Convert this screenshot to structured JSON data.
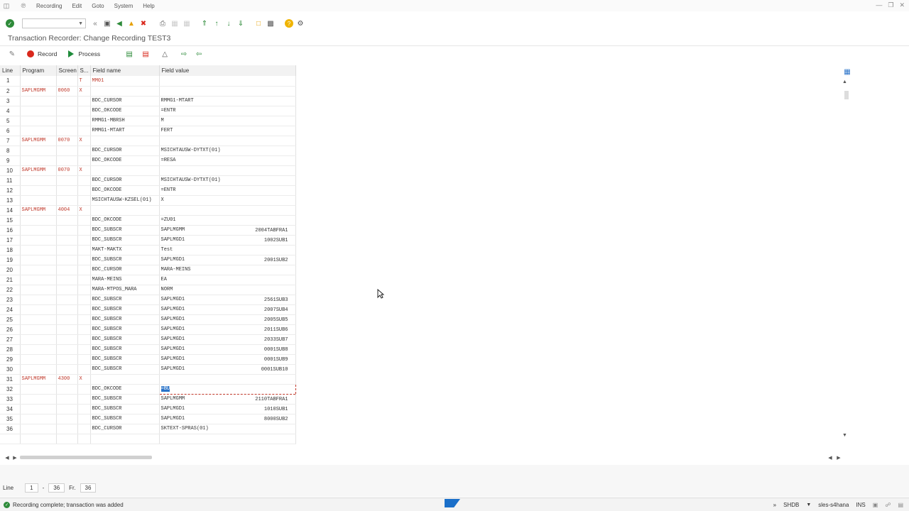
{
  "menu": {
    "items": [
      "Recording",
      "Edit",
      "Goto",
      "System",
      "Help"
    ]
  },
  "window_title": "Transaction Recorder: Change Recording TEST3",
  "toolbar": {
    "record_label": "Record",
    "process_label": "Process"
  },
  "grid": {
    "columns": [
      "Line",
      "Program",
      "Screen",
      "S...",
      "Field name",
      "Field value"
    ],
    "rows": [
      {
        "line": "1",
        "program": "",
        "screen": "",
        "s": "T",
        "field": "MM01",
        "value": "",
        "extra": ""
      },
      {
        "line": "2",
        "program": "SAPLMGMM",
        "screen": "0060",
        "s": "X",
        "field": "",
        "value": "",
        "extra": ""
      },
      {
        "line": "3",
        "program": "",
        "screen": "",
        "s": "",
        "field": "BDC_CURSOR",
        "value": "RMMG1-MTART",
        "extra": ""
      },
      {
        "line": "4",
        "program": "",
        "screen": "",
        "s": "",
        "field": "BDC_OKCODE",
        "value": "=ENTR",
        "extra": ""
      },
      {
        "line": "5",
        "program": "",
        "screen": "",
        "s": "",
        "field": "RMMG1-MBRSH",
        "value": "M",
        "extra": ""
      },
      {
        "line": "6",
        "program": "",
        "screen": "",
        "s": "",
        "field": "RMMG1-MTART",
        "value": "FERT",
        "extra": ""
      },
      {
        "line": "7",
        "program": "SAPLMGMM",
        "screen": "0070",
        "s": "X",
        "field": "",
        "value": "",
        "extra": ""
      },
      {
        "line": "8",
        "program": "",
        "screen": "",
        "s": "",
        "field": "BDC_CURSOR",
        "value": "MSICHTAUSW-DYTXT(01)",
        "extra": ""
      },
      {
        "line": "9",
        "program": "",
        "screen": "",
        "s": "",
        "field": "BDC_OKCODE",
        "value": "=RESA",
        "extra": ""
      },
      {
        "line": "10",
        "program": "SAPLMGMM",
        "screen": "0070",
        "s": "X",
        "field": "",
        "value": "",
        "extra": ""
      },
      {
        "line": "11",
        "program": "",
        "screen": "",
        "s": "",
        "field": "BDC_CURSOR",
        "value": "MSICHTAUSW-DYTXT(01)",
        "extra": ""
      },
      {
        "line": "12",
        "program": "",
        "screen": "",
        "s": "",
        "field": "BDC_OKCODE",
        "value": "=ENTR",
        "extra": ""
      },
      {
        "line": "13",
        "program": "",
        "screen": "",
        "s": "",
        "field": "MSICHTAUSW-KZSEL(01)",
        "value": "X",
        "extra": ""
      },
      {
        "line": "14",
        "program": "SAPLMGMM",
        "screen": "4004",
        "s": "X",
        "field": "",
        "value": "",
        "extra": ""
      },
      {
        "line": "15",
        "program": "",
        "screen": "",
        "s": "",
        "field": "BDC_OKCODE",
        "value": "=ZU01",
        "extra": ""
      },
      {
        "line": "16",
        "program": "",
        "screen": "",
        "s": "",
        "field": "BDC_SUBSCR",
        "value": "SAPLMGMM",
        "extra": "2004TABFRA1"
      },
      {
        "line": "17",
        "program": "",
        "screen": "",
        "s": "",
        "field": "BDC_SUBSCR",
        "value": "SAPLMGD1",
        "extra": "1002SUB1"
      },
      {
        "line": "18",
        "program": "",
        "screen": "",
        "s": "",
        "field": "MAKT-MAKTX",
        "value": "Test",
        "extra": ""
      },
      {
        "line": "19",
        "program": "",
        "screen": "",
        "s": "",
        "field": "BDC_SUBSCR",
        "value": "SAPLMGD1",
        "extra": "2001SUB2"
      },
      {
        "line": "20",
        "program": "",
        "screen": "",
        "s": "",
        "field": "BDC_CURSOR",
        "value": "MARA-MEINS",
        "extra": ""
      },
      {
        "line": "21",
        "program": "",
        "screen": "",
        "s": "",
        "field": "MARA-MEINS",
        "value": "EA",
        "extra": ""
      },
      {
        "line": "22",
        "program": "",
        "screen": "",
        "s": "",
        "field": "MARA-MTPOS_MARA",
        "value": "NORM",
        "extra": ""
      },
      {
        "line": "23",
        "program": "",
        "screen": "",
        "s": "",
        "field": "BDC_SUBSCR",
        "value": "SAPLMGD1",
        "extra": "2561SUB3"
      },
      {
        "line": "24",
        "program": "",
        "screen": "",
        "s": "",
        "field": "BDC_SUBSCR",
        "value": "SAPLMGD1",
        "extra": "2007SUB4"
      },
      {
        "line": "25",
        "program": "",
        "screen": "",
        "s": "",
        "field": "BDC_SUBSCR",
        "value": "SAPLMGD1",
        "extra": "2005SUB5"
      },
      {
        "line": "26",
        "program": "",
        "screen": "",
        "s": "",
        "field": "BDC_SUBSCR",
        "value": "SAPLMGD1",
        "extra": "2011SUB6"
      },
      {
        "line": "27",
        "program": "",
        "screen": "",
        "s": "",
        "field": "BDC_SUBSCR",
        "value": "SAPLMGD1",
        "extra": "2033SUB7"
      },
      {
        "line": "28",
        "program": "",
        "screen": "",
        "s": "",
        "field": "BDC_SUBSCR",
        "value": "SAPLMGD1",
        "extra": "0001SUB8"
      },
      {
        "line": "29",
        "program": "",
        "screen": "",
        "s": "",
        "field": "BDC_SUBSCR",
        "value": "SAPLMGD1",
        "extra": "0001SUB9"
      },
      {
        "line": "30",
        "program": "",
        "screen": "",
        "s": "",
        "field": "BDC_SUBSCR",
        "value": "SAPLMGD1",
        "extra": "0001SUB10"
      },
      {
        "line": "31",
        "program": "SAPLMGMM",
        "screen": "4300",
        "s": "X",
        "field": "",
        "value": "",
        "extra": ""
      },
      {
        "line": "32",
        "program": "",
        "screen": "",
        "s": "",
        "field": "BDC_OKCODE",
        "value": "=BU",
        "extra": "",
        "highlight": true
      },
      {
        "line": "33",
        "program": "",
        "screen": "",
        "s": "",
        "field": "BDC_SUBSCR",
        "value": "SAPLMGMM",
        "extra": "2110TABFRA1"
      },
      {
        "line": "34",
        "program": "",
        "screen": "",
        "s": "",
        "field": "BDC_SUBSCR",
        "value": "SAPLMGD1",
        "extra": "1010SUB1"
      },
      {
        "line": "35",
        "program": "",
        "screen": "",
        "s": "",
        "field": "BDC_SUBSCR",
        "value": "SAPLMGD1",
        "extra": "8000SUB2"
      },
      {
        "line": "36",
        "program": "",
        "screen": "",
        "s": "",
        "field": "BDC_CURSOR",
        "value": "SKTEXT-SPRAS(01)",
        "extra": ""
      }
    ]
  },
  "linebar": {
    "label": "Line",
    "from": "1",
    "dash": "-",
    "to": "36",
    "fr_label": "Fr.",
    "total": "36"
  },
  "status": {
    "message": "Recording complete; transaction was added",
    "system": "SHDB",
    "server": "sles-s4hana",
    "mode": "INS"
  },
  "colors": {
    "accent_red": "#c0392b",
    "record_red": "#d9281c",
    "process_green": "#1e8b3a",
    "sap_blue": "#1a6fc9"
  }
}
